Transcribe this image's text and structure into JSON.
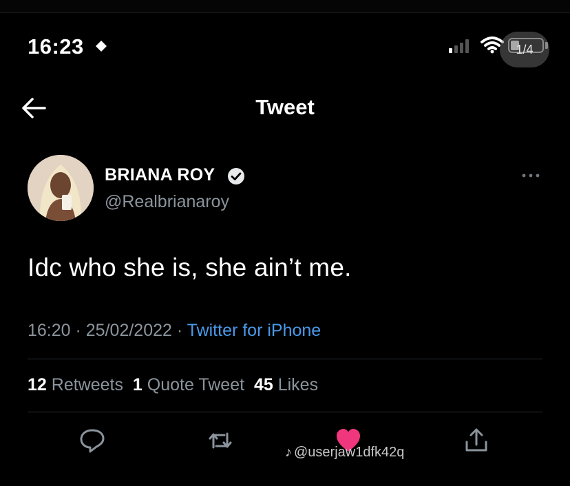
{
  "status_bar": {
    "time": "16:23",
    "page_indicator": "1/4",
    "battery_level": 0.24
  },
  "header": {
    "title": "Tweet"
  },
  "author": {
    "name": "BRIANA ROY",
    "handle": "@Realbrianaroy",
    "verified": true
  },
  "tweet": {
    "text": "Idc who she is, she ain’t me.",
    "time": "16:20",
    "date": "25/02/2022",
    "source": "Twitter for iPhone"
  },
  "stats": {
    "retweets_count": "12",
    "retweets_label": "Retweets",
    "quotes_count": "1",
    "quotes_label": "Quote Tweet",
    "likes_count": "45",
    "likes_label": "Likes"
  },
  "actions": [
    "reply-icon",
    "retweet-icon",
    "like-icon",
    "share-icon"
  ],
  "watermark": {
    "text": "@userjaw1dfk42q"
  },
  "colors": {
    "background": "#000000",
    "accent": "#4a99e9",
    "muted": "#8b949c",
    "like": "#f0377d"
  }
}
